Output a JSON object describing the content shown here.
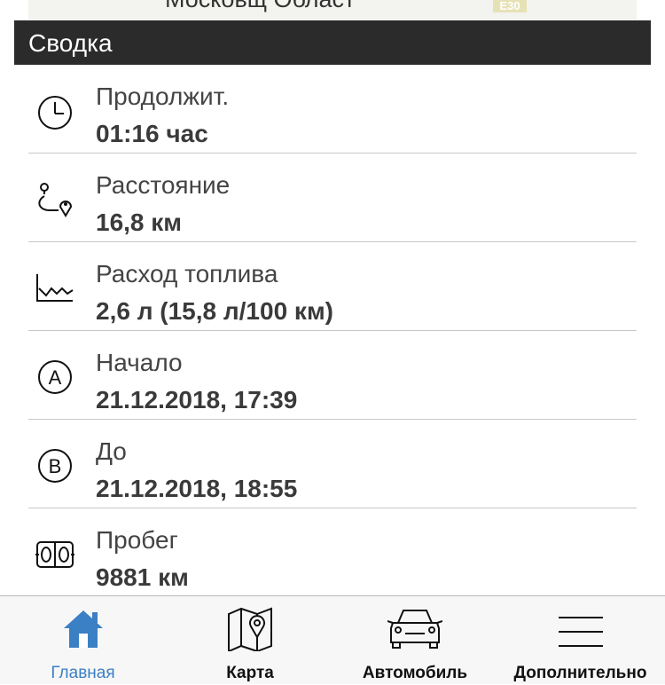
{
  "map": {
    "place_text": "Московщ Област",
    "road_tag": "E30"
  },
  "header": {
    "title": "Сводка"
  },
  "summary": {
    "items": [
      {
        "label": "Продолжит.",
        "value": "01:16 час",
        "icon": "clock-icon"
      },
      {
        "label": "Расстояние",
        "value": "16,8 км",
        "icon": "route-icon"
      },
      {
        "label": "Расход топлива",
        "value": "2,6 л (15,8 л/100 км)",
        "icon": "fuel-chart-icon"
      },
      {
        "label": "Начало",
        "value": "21.12.2018, 17:39",
        "icon": "point-a-icon"
      },
      {
        "label": "До",
        "value": "21.12.2018, 18:55",
        "icon": "point-b-icon"
      },
      {
        "label": "Пробег",
        "value": "9881 км",
        "icon": "odometer-icon"
      }
    ]
  },
  "tabbar": {
    "tabs": [
      {
        "label": "Главная",
        "icon": "home-icon",
        "active": true
      },
      {
        "label": "Карта",
        "icon": "map-icon",
        "active": false
      },
      {
        "label": "Автомобиль",
        "icon": "car-icon",
        "active": false
      },
      {
        "label": "Дополнительно",
        "icon": "menu-icon",
        "active": false
      }
    ]
  },
  "colors": {
    "header_bg": "#2b2b2b",
    "accent": "#3b7fc4",
    "divider": "#c8c8c8"
  }
}
